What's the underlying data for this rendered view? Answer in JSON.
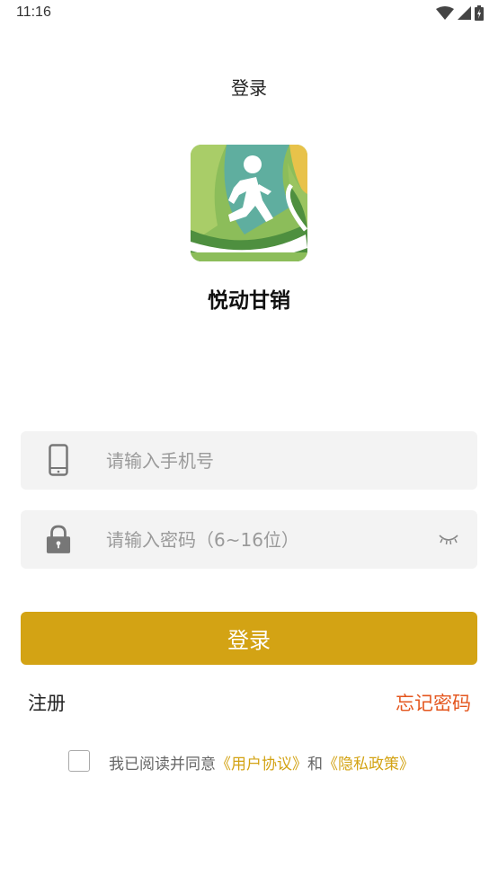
{
  "status_bar": {
    "time": "11:16",
    "icons": [
      "wifi-icon",
      "signal-icon",
      "battery-charging-icon"
    ]
  },
  "header": {
    "title": "登录"
  },
  "app": {
    "name": "悦动甘销",
    "logo_icon": "runner-logo-icon",
    "logo_colors": {
      "teal": "#5fae9f",
      "green": "#8cbd5a",
      "light_green": "#b6d57a",
      "yellow": "#e8c24a",
      "dark_green": "#4e8f3f"
    }
  },
  "form": {
    "phone": {
      "placeholder": "请输入手机号",
      "value": "",
      "icon": "phone-icon"
    },
    "password": {
      "placeholder": "请输入密码（6~16位）",
      "value": "",
      "icon": "lock-icon",
      "toggle_icon": "eye-closed-icon"
    }
  },
  "login_button": {
    "label": "登录",
    "color": "#d3a314"
  },
  "links": {
    "register": "注册",
    "forgot": "忘记密码",
    "forgot_color": "#e4561e"
  },
  "agreement": {
    "checked": false,
    "prefix": "我已阅读并同意",
    "user_agreement": "《用户协议》",
    "and": "和",
    "privacy_policy": "《隐私政策》"
  }
}
